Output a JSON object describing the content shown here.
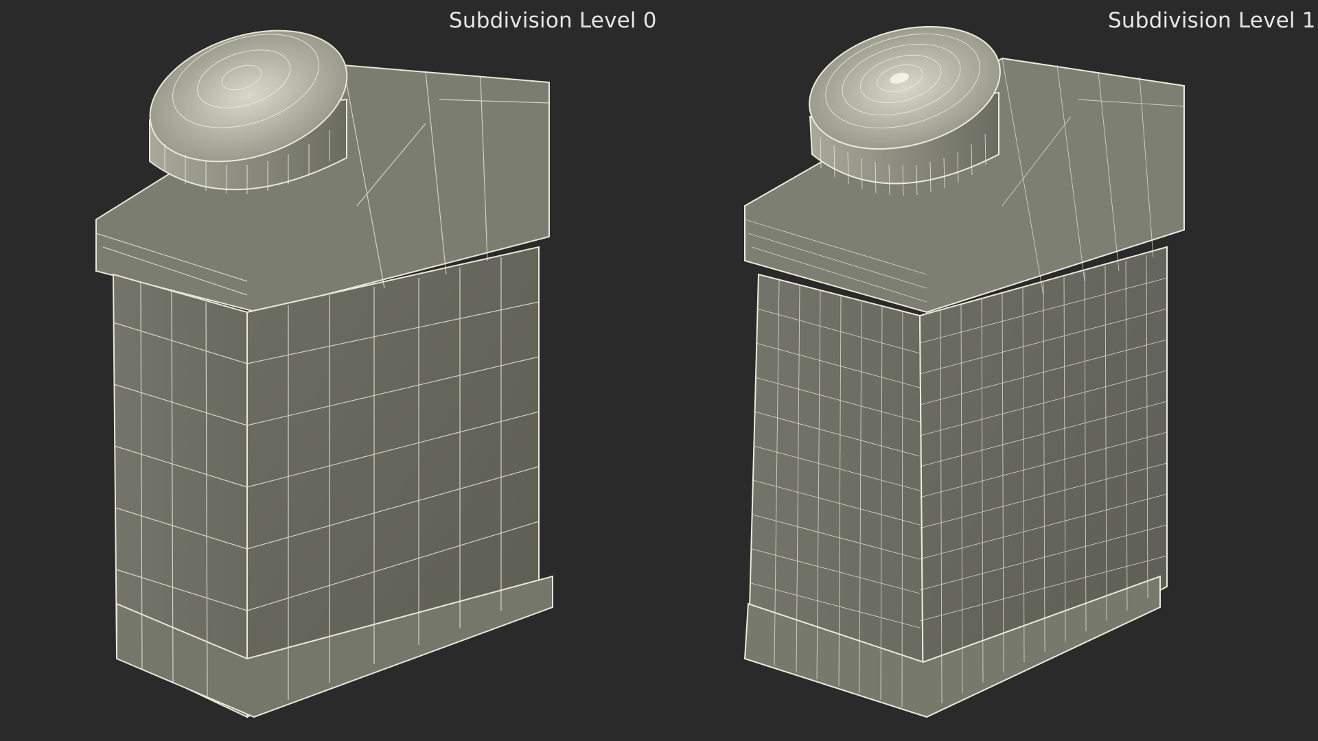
{
  "panels": [
    {
      "label": "Subdivision Level 0"
    },
    {
      "label": "Subdivision Level 1"
    }
  ],
  "colors": {
    "background": "#2a2a2a",
    "surface_light": "#8a8b7d",
    "surface_dark": "#5e5f55",
    "wire": "#ecebdc"
  }
}
